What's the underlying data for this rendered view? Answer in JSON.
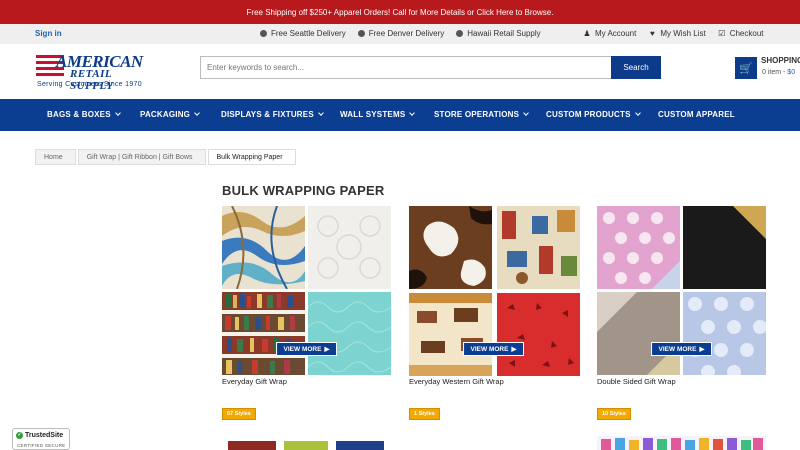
{
  "promo": "Free Shipping off $250+ Apparel Orders! Call for More Details or Click Here to Browse.",
  "utility": {
    "signin": "Sign in",
    "delivery": [
      "Free Seattle Delivery",
      "Free Denver Delivery",
      "Hawaii Retail Supply"
    ],
    "account": [
      "My Account",
      "My Wish List",
      "Checkout"
    ]
  },
  "logo": {
    "line1": "AMERICAN",
    "line2": "RETAIL SUPPLY",
    "tagline": "Serving Customers Since 1970"
  },
  "search": {
    "placeholder": "Enter keywords to search...",
    "button": "Search"
  },
  "cart": {
    "title": "SHOPPING",
    "count": "0 item",
    "price": "$0"
  },
  "nav": [
    "BAGS & BOXES",
    "PACKAGING",
    "DISPLAYS & FIXTURES",
    "WALL SYSTEMS",
    "STORE OPERATIONS",
    "CUSTOM PRODUCTS",
    "CUSTOM APPAREL"
  ],
  "breadcrumb": [
    "Home",
    "Gift Wrap | Gift Ribbon | Gift Bows",
    "Bulk Wrapping Paper"
  ],
  "page_title": "BULK WRAPPING PAPER",
  "products": [
    {
      "name": "Everyday Gift Wrap",
      "view_more": "VIEW MORE",
      "badge": "57 Styles"
    },
    {
      "name": "Everyday Western Gift Wrap",
      "view_more": "VIEW MORE",
      "badge": "1 Styles"
    },
    {
      "name": "Double Sided Gift Wrap",
      "view_more": "VIEW MORE",
      "badge": "10 Styles"
    }
  ],
  "trusted": {
    "title": "TrustedSite",
    "sub": "CERTIFIED SECURE"
  },
  "colors": {
    "promo": "#b8191d",
    "nav": "#0b3d91",
    "accent": "#1d64b4",
    "badge": "#f4a900"
  }
}
